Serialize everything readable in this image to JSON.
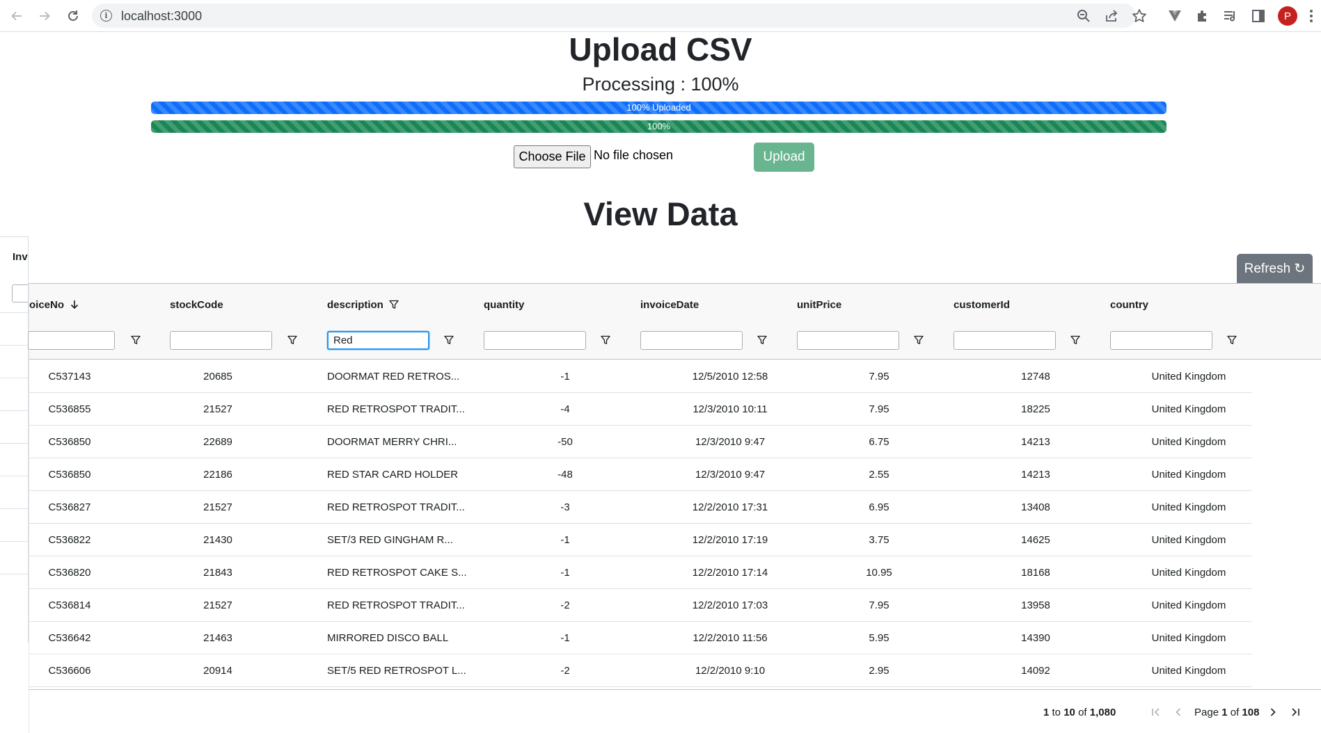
{
  "browser": {
    "url": "localhost:3000",
    "profile_initial": "P"
  },
  "upload": {
    "title": "Upload CSV",
    "processing": "Processing : 100%",
    "upload_progress": {
      "label": "100% Uploaded",
      "percent": 100,
      "color": "#0d6efd"
    },
    "process_progress": {
      "label": "100%",
      "percent": 100,
      "color": "#198754"
    },
    "choose_file_label": "Choose File",
    "file_status": "No file chosen",
    "upload_button": "Upload"
  },
  "view": {
    "title": "View Data",
    "refresh_button": "Refresh ↻",
    "ghost_header": "Inv"
  },
  "grid": {
    "columns": [
      {
        "header": "oiceNo",
        "sort": "desc",
        "filter_icon_in_header": false,
        "filter_value": ""
      },
      {
        "header": "stockCode",
        "filter_icon_in_header": false,
        "filter_value": ""
      },
      {
        "header": "description",
        "filter_icon_in_header": true,
        "filter_value": "Red"
      },
      {
        "header": "quantity",
        "filter_icon_in_header": false,
        "filter_value": ""
      },
      {
        "header": "invoiceDate",
        "filter_icon_in_header": false,
        "filter_value": ""
      },
      {
        "header": "unitPrice",
        "filter_icon_in_header": false,
        "filter_value": ""
      },
      {
        "header": "customerId",
        "filter_icon_in_header": false,
        "filter_value": ""
      },
      {
        "header": "country",
        "filter_icon_in_header": false,
        "filter_value": ""
      }
    ],
    "rows": [
      [
        "C537143",
        "20685",
        "DOORMAT RED RETROS...",
        "-1",
        "12/5/2010 12:58",
        "7.95",
        "12748",
        "United Kingdom"
      ],
      [
        "C536855",
        "21527",
        "RED RETROSPOT TRADIT...",
        "-4",
        "12/3/2010 10:11",
        "7.95",
        "18225",
        "United Kingdom"
      ],
      [
        "C536850",
        "22689",
        "DOORMAT MERRY CHRI...",
        "-50",
        "12/3/2010 9:47",
        "6.75",
        "14213",
        "United Kingdom"
      ],
      [
        "C536850",
        "22186",
        "RED STAR CARD HOLDER",
        "-48",
        "12/3/2010 9:47",
        "2.55",
        "14213",
        "United Kingdom"
      ],
      [
        "C536827",
        "21527",
        "RED RETROSPOT TRADIT...",
        "-3",
        "12/2/2010 17:31",
        "6.95",
        "13408",
        "United Kingdom"
      ],
      [
        "C536822",
        "21430",
        "SET/3 RED GINGHAM R...",
        "-1",
        "12/2/2010 17:19",
        "3.75",
        "14625",
        "United Kingdom"
      ],
      [
        "C536820",
        "21843",
        "RED RETROSPOT CAKE S...",
        "-1",
        "12/2/2010 17:14",
        "10.95",
        "18168",
        "United Kingdom"
      ],
      [
        "C536814",
        "21527",
        "RED RETROSPOT TRADIT...",
        "-2",
        "12/2/2010 17:03",
        "7.95",
        "13958",
        "United Kingdom"
      ],
      [
        "C536642",
        "21463",
        "MIRRORED DISCO BALL",
        "-1",
        "12/2/2010 11:56",
        "5.95",
        "14390",
        "United Kingdom"
      ],
      [
        "C536606",
        "20914",
        "SET/5 RED RETROSPOT L...",
        "-2",
        "12/2/2010 9:10",
        "2.95",
        "14092",
        "United Kingdom"
      ]
    ]
  },
  "pagination": {
    "from": "1",
    "to_word": "to",
    "to": "10",
    "of_word": "of",
    "total": "1,080",
    "page_word": "Page",
    "page": "1",
    "page_count": "108"
  }
}
